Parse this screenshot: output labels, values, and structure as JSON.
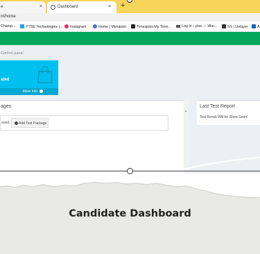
{
  "browser": {
    "tabs": [
      {
        "label": "e"
      },
      {
        "label": "Dashboard"
      }
    ],
    "new_tab_symbol": "+",
    "close_symbol": "×",
    "address": "nt/home",
    "bookmarks": [
      {
        "label": "Champ...",
        "icon": "page-icon",
        "color": "#888888"
      },
      {
        "label": "YTSE Technologies (...",
        "icon": "twitter-icon",
        "color": "#1da1f2"
      },
      {
        "label": "Instagram",
        "icon": "instagram-icon",
        "color": "#e1306c"
      },
      {
        "label": "Home | Mynaukri",
        "icon": "naukri-icon",
        "color": "#4a6ee0"
      },
      {
        "label": "Timesjobs:My Time...",
        "icon": "timesjobs-icon",
        "color": "#222222"
      },
      {
        "label": "Log In ‹ ytse — Wor...",
        "icon": "menu-icon",
        "color": "#555555"
      },
      {
        "label": "SS | Unlayer",
        "icon": "unlayer-icon",
        "color": "#333333"
      },
      {
        "label": "A",
        "icon": "linkedin-icon",
        "color": "#0a66c2"
      }
    ]
  },
  "page": {
    "breadcrumb": "Control panel",
    "small_box": {
      "title": "ated",
      "footer": "More info"
    },
    "packages_panel": {
      "title": "ages",
      "empty_text": "ound.",
      "add_button": "Add Test Package"
    },
    "report_panel": {
      "title": "Last Test Report",
      "message": "Test Result Will be Show Soon!"
    }
  },
  "caption": {
    "heading": "Candidate Dashboard"
  },
  "colors": {
    "tab_bar": "#f7d45a",
    "header_green": "#00a65a",
    "small_box": "#00c0ef",
    "content_bg": "#ecf0f5"
  }
}
